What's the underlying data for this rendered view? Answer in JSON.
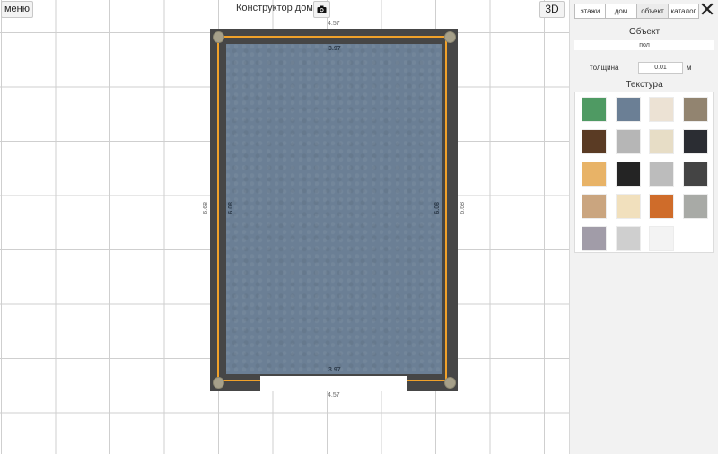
{
  "toolbar": {
    "menu_label": "меню",
    "title": "Конструктор дома",
    "camera_icon": "camera-icon",
    "view3d_label": "3D"
  },
  "plan": {
    "dim_top_outer": "4.57",
    "dim_top_inner": "3.97",
    "dim_bottom_inner": "3.97",
    "dim_bottom_outer": "4.57",
    "dim_left_outer": "6.68",
    "dim_left_inner": "6.08",
    "dim_right_inner": "6.08",
    "dim_right_outer": "6.68",
    "floor_color": "#6b7f95",
    "wall_color": "#464646",
    "wall_line_color": "#f0a12a"
  },
  "panel": {
    "tabs": [
      {
        "label": "этажи"
      },
      {
        "label": "дом"
      },
      {
        "label": "объект"
      },
      {
        "label": "каталог"
      }
    ],
    "close_icon": "close-icon",
    "heading": "Объект",
    "object_type": "пол",
    "thickness_label": "толщина",
    "thickness_value": "0.01",
    "thickness_unit": "м",
    "texture_heading": "Текстура",
    "textures": [
      {
        "name": "green-tile",
        "color": "#4f9a63"
      },
      {
        "name": "blue-grey",
        "color": "#6b7f95"
      },
      {
        "name": "light-wood",
        "color": "#ece2d4"
      },
      {
        "name": "grey-wood",
        "color": "#928470"
      },
      {
        "name": "dark-wood",
        "color": "#5a3b24"
      },
      {
        "name": "grey-parquet",
        "color": "#b6b6b6"
      },
      {
        "name": "cream-wood",
        "color": "#e7ddc6"
      },
      {
        "name": "black-texture",
        "color": "#2b2d33"
      },
      {
        "name": "light-oak",
        "color": "#e8b367"
      },
      {
        "name": "black-stone",
        "color": "#242424"
      },
      {
        "name": "grey-marble",
        "color": "#bcbcbc"
      },
      {
        "name": "pattern-tile",
        "color": "#444444"
      },
      {
        "name": "dotted-tile",
        "color": "#caa57f"
      },
      {
        "name": "beige-wood",
        "color": "#f1e0bd"
      },
      {
        "name": "orange-pattern",
        "color": "#cf6c2a"
      },
      {
        "name": "grey-stone",
        "color": "#a8aaa6"
      },
      {
        "name": "lilac-grey",
        "color": "#a19ca8"
      },
      {
        "name": "light-grey",
        "color": "#cfcfcf"
      },
      {
        "name": "white",
        "color": "#f3f3f3"
      }
    ]
  }
}
